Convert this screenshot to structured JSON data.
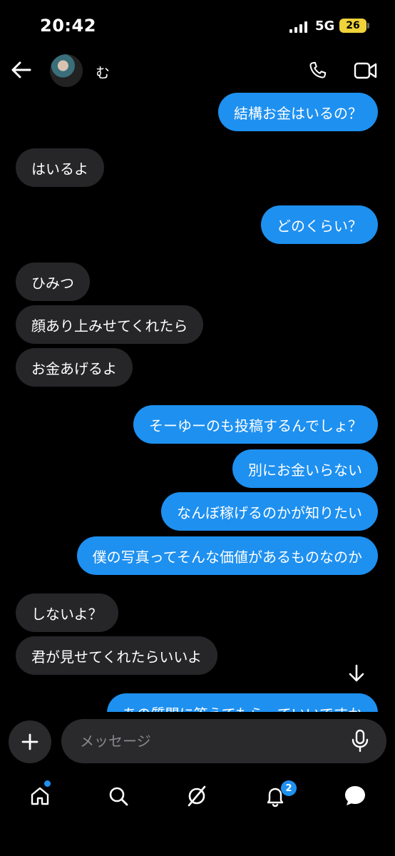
{
  "status": {
    "time": "20:42",
    "network": "5G",
    "battery": "26"
  },
  "header": {
    "contact_name": "む"
  },
  "messages": [
    {
      "side": "sent",
      "text": "結構お金はいるの？"
    },
    {
      "side": "recv",
      "text": "はいるよ"
    },
    {
      "side": "sent",
      "text": "どのくらい？"
    },
    {
      "side": "recv",
      "text": "ひみつ"
    },
    {
      "side": "recv",
      "text": "顔あり上みせてくれたら"
    },
    {
      "side": "recv",
      "text": "お金あげるよ"
    },
    {
      "side": "sent",
      "text": "そーゆーのも投稿するんでしょ？"
    },
    {
      "side": "sent",
      "text": "別にお金いらない"
    },
    {
      "side": "sent",
      "text": "なんぼ稼げるのかが知りたい"
    },
    {
      "side": "sent",
      "text": "僕の写真ってそんな価値があるものなのか"
    },
    {
      "side": "recv",
      "text": "しないよ？"
    },
    {
      "side": "recv",
      "text": "君が見せてくれたらいいよ"
    },
    {
      "side": "sent",
      "text": "あの質問に答えてもらっていいですか"
    }
  ],
  "composer": {
    "placeholder": "メッセージ"
  },
  "nav": {
    "notification_count": "2"
  },
  "colors": {
    "sent_bubble": "#1e90f0",
    "recv_bubble": "#262629",
    "background": "#000000"
  }
}
